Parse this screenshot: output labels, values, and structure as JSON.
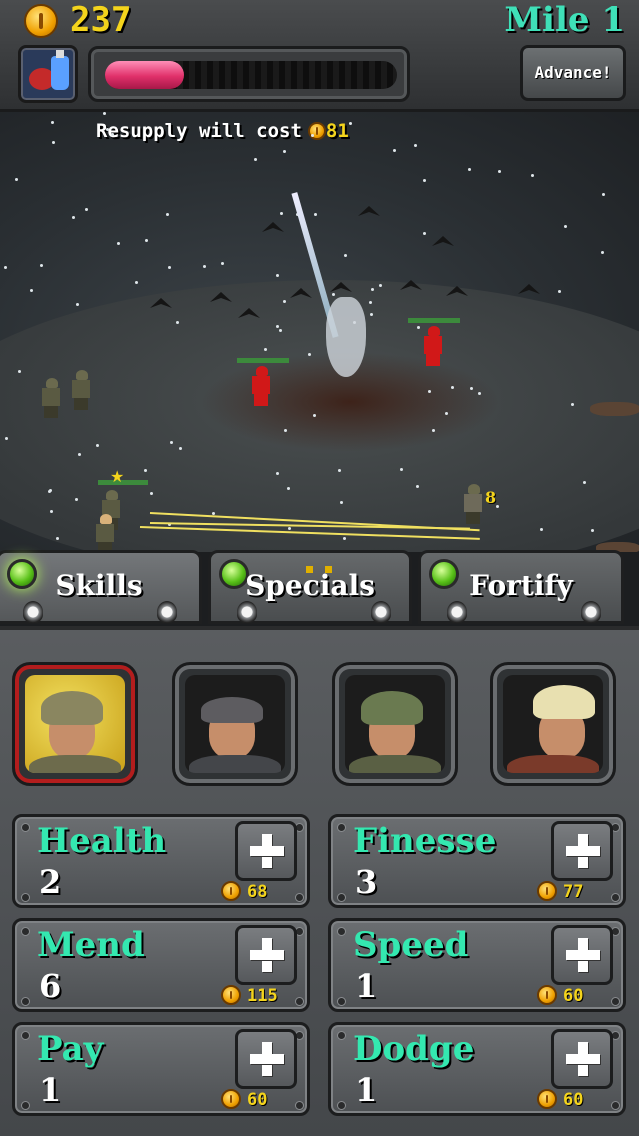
{
  "hud": {
    "gold": "237",
    "mile": "Mile 1",
    "advance_label": "Advance!",
    "supply_progress": 0.27,
    "resupply_text": "Resupply will cost",
    "resupply_cost": "81"
  },
  "battle": {
    "damage_number": "8"
  },
  "tabs": [
    {
      "label": "Skills",
      "active": true
    },
    {
      "label": "Specials",
      "active": false
    },
    {
      "label": "Fortify",
      "active": false
    }
  ],
  "portraits": [
    {
      "name": "soldier-helmet-tan",
      "active": true
    },
    {
      "name": "soldier-cap-officer",
      "active": false
    },
    {
      "name": "soldier-camo-helmet",
      "active": false
    },
    {
      "name": "soldier-blonde-sniper",
      "active": false
    }
  ],
  "stats": [
    {
      "name": "Health",
      "value": "2",
      "cost": "68"
    },
    {
      "name": "Finesse",
      "value": "3",
      "cost": "77"
    },
    {
      "name": "Mend",
      "value": "6",
      "cost": "115"
    },
    {
      "name": "Speed",
      "value": "1",
      "cost": "60"
    },
    {
      "name": "Pay",
      "value": "1",
      "cost": "60"
    },
    {
      "name": "Dodge",
      "value": "1",
      "cost": "60"
    }
  ],
  "colors": {
    "gold": "#f4d41c",
    "stat_name": "#34e8b0",
    "supply_bar": "#e0306a",
    "enemy": "#d11818"
  }
}
